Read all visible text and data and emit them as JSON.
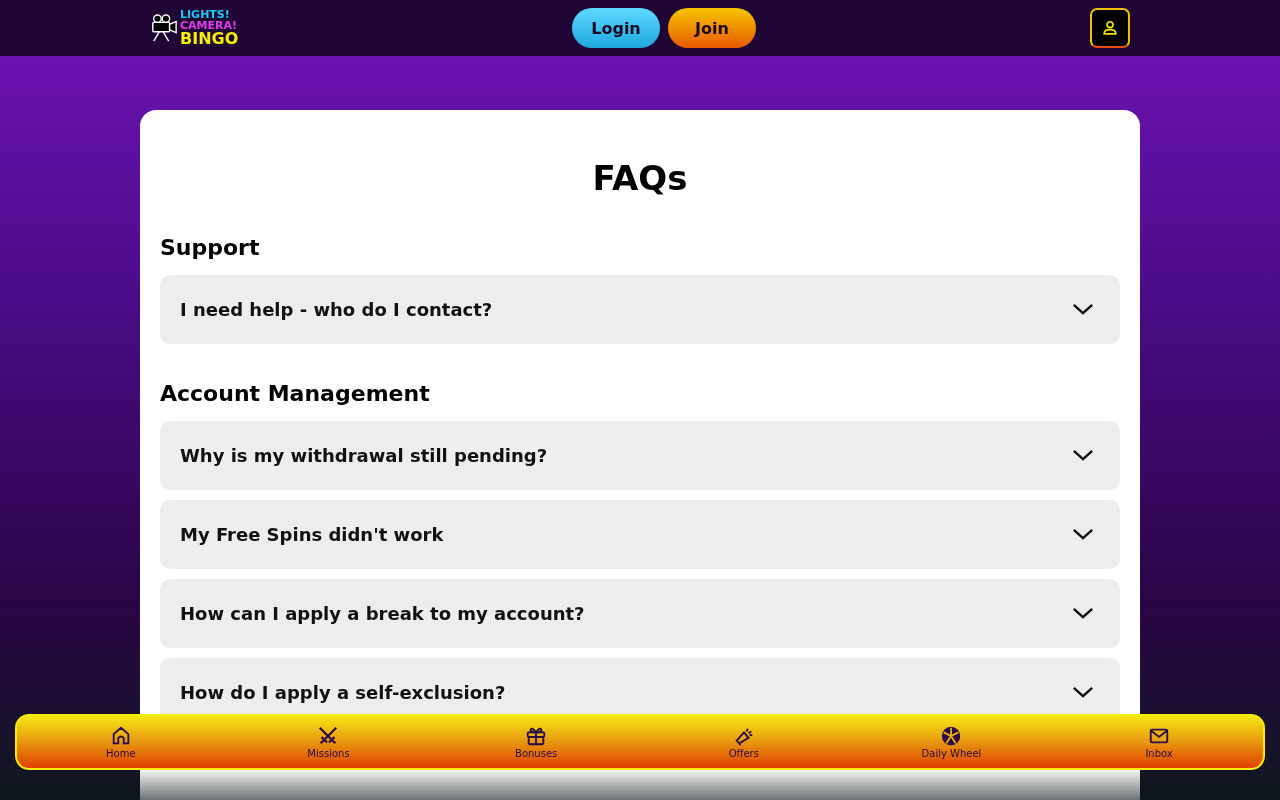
{
  "header": {
    "logo": [
      "LIGHTS!",
      "CAMERA!",
      "BINGO"
    ],
    "buttons": [
      {
        "label": "Login",
        "kind": "login"
      },
      {
        "label": "Join",
        "kind": "join"
      }
    ]
  },
  "faq": {
    "title": "FAQs",
    "sections": [
      {
        "heading": "Support",
        "items": [
          {
            "question": "I need help - who do I contact?",
            "expanded": false
          }
        ]
      },
      {
        "heading": "Account Management",
        "items": [
          {
            "question": "Why is my withdrawal still pending?",
            "expanded": false
          },
          {
            "question": "My Free Spins didn't work",
            "expanded": false
          },
          {
            "question": "How can I apply a break to my account?",
            "expanded": false
          },
          {
            "question": "How do I apply a self-exclusion?",
            "expanded": false
          }
        ]
      }
    ]
  },
  "bottom_nav": [
    {
      "label": "Home"
    },
    {
      "label": "Missions"
    },
    {
      "label": "Bonuses"
    },
    {
      "label": "Offers"
    },
    {
      "label": "Daily Wheel"
    },
    {
      "label": "Inbox"
    }
  ]
}
